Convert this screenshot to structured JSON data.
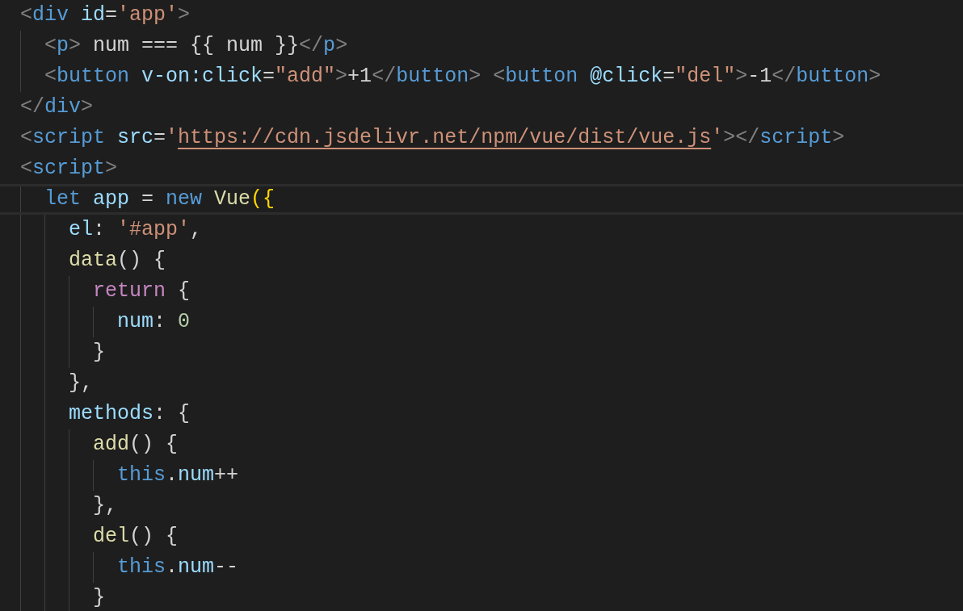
{
  "editor": {
    "lines": [
      {
        "current": false,
        "tokens": [
          {
            "text": "<",
            "kind": "punct"
          },
          {
            "text": "div",
            "kind": "tag"
          },
          {
            "text": " id",
            "kind": "attr"
          },
          {
            "text": "=",
            "kind": "plain"
          },
          {
            "text": "'app'",
            "kind": "string"
          },
          {
            "text": ">",
            "kind": "punct"
          }
        ]
      },
      {
        "current": false,
        "tokens": [
          {
            "text": "  <",
            "kind": "punct"
          },
          {
            "text": "p",
            "kind": "tag"
          },
          {
            "text": ">",
            "kind": "punct"
          },
          {
            "text": " num === {{ num }}",
            "kind": "plain"
          },
          {
            "text": "</",
            "kind": "punct"
          },
          {
            "text": "p",
            "kind": "tag"
          },
          {
            "text": ">",
            "kind": "punct"
          }
        ]
      },
      {
        "current": false,
        "tokens": [
          {
            "text": "  <",
            "kind": "punct"
          },
          {
            "text": "button",
            "kind": "tag"
          },
          {
            "text": " v-on:click",
            "kind": "attr"
          },
          {
            "text": "=",
            "kind": "plain"
          },
          {
            "text": "\"add\"",
            "kind": "string"
          },
          {
            "text": ">",
            "kind": "punct"
          },
          {
            "text": "+1",
            "kind": "plain"
          },
          {
            "text": "</",
            "kind": "punct"
          },
          {
            "text": "button",
            "kind": "tag"
          },
          {
            "text": ">",
            "kind": "punct"
          },
          {
            "text": " <",
            "kind": "punct"
          },
          {
            "text": "button",
            "kind": "tag"
          },
          {
            "text": " @click",
            "kind": "attr"
          },
          {
            "text": "=",
            "kind": "plain"
          },
          {
            "text": "\"del\"",
            "kind": "string"
          },
          {
            "text": ">",
            "kind": "punct"
          },
          {
            "text": "-1",
            "kind": "plain"
          },
          {
            "text": "</",
            "kind": "punct"
          },
          {
            "text": "button",
            "kind": "tag"
          },
          {
            "text": ">",
            "kind": "punct"
          }
        ]
      },
      {
        "current": false,
        "tokens": [
          {
            "text": "</",
            "kind": "punct"
          },
          {
            "text": "div",
            "kind": "tag"
          },
          {
            "text": ">",
            "kind": "punct"
          }
        ]
      },
      {
        "current": false,
        "tokens": [
          {
            "text": "<",
            "kind": "punct"
          },
          {
            "text": "script",
            "kind": "tag"
          },
          {
            "text": " src",
            "kind": "attr"
          },
          {
            "text": "=",
            "kind": "plain"
          },
          {
            "text": "'",
            "kind": "string"
          },
          {
            "text": "https://cdn.jsdelivr.net/npm/vue/dist/vue.js",
            "kind": "link"
          },
          {
            "text": "'",
            "kind": "string"
          },
          {
            "text": "></",
            "kind": "punct"
          },
          {
            "text": "script",
            "kind": "tag"
          },
          {
            "text": ">",
            "kind": "punct"
          }
        ]
      },
      {
        "current": false,
        "tokens": [
          {
            "text": "<",
            "kind": "punct"
          },
          {
            "text": "script",
            "kind": "tag"
          },
          {
            "text": ">",
            "kind": "punct"
          }
        ]
      },
      {
        "current": true,
        "tokens": [
          {
            "text": "  let",
            "kind": "keyword"
          },
          {
            "text": " app",
            "kind": "variable"
          },
          {
            "text": " = ",
            "kind": "plain"
          },
          {
            "text": "new",
            "kind": "keyword"
          },
          {
            "text": " Vue",
            "kind": "function"
          },
          {
            "text": "({",
            "kind": "bracket"
          }
        ]
      },
      {
        "current": false,
        "tokens": [
          {
            "text": "    el",
            "kind": "variable"
          },
          {
            "text": ": ",
            "kind": "plain"
          },
          {
            "text": "'#app'",
            "kind": "string"
          },
          {
            "text": ",",
            "kind": "plain"
          }
        ]
      },
      {
        "current": false,
        "tokens": [
          {
            "text": "    data",
            "kind": "function"
          },
          {
            "text": "() {",
            "kind": "plain"
          }
        ]
      },
      {
        "current": false,
        "tokens": [
          {
            "text": "      return",
            "kind": "control"
          },
          {
            "text": " {",
            "kind": "plain"
          }
        ]
      },
      {
        "current": false,
        "tokens": [
          {
            "text": "        num",
            "kind": "variable"
          },
          {
            "text": ": ",
            "kind": "plain"
          },
          {
            "text": "0",
            "kind": "number"
          }
        ]
      },
      {
        "current": false,
        "tokens": [
          {
            "text": "      }",
            "kind": "plain"
          }
        ]
      },
      {
        "current": false,
        "tokens": [
          {
            "text": "    },",
            "kind": "plain"
          }
        ]
      },
      {
        "current": false,
        "tokens": [
          {
            "text": "    methods",
            "kind": "variable"
          },
          {
            "text": ": {",
            "kind": "plain"
          }
        ]
      },
      {
        "current": false,
        "tokens": [
          {
            "text": "      add",
            "kind": "function"
          },
          {
            "text": "() {",
            "kind": "plain"
          }
        ]
      },
      {
        "current": false,
        "tokens": [
          {
            "text": "        this",
            "kind": "keyword"
          },
          {
            "text": ".",
            "kind": "plain"
          },
          {
            "text": "num",
            "kind": "variable"
          },
          {
            "text": "++",
            "kind": "plain"
          }
        ]
      },
      {
        "current": false,
        "tokens": [
          {
            "text": "      },",
            "kind": "plain"
          }
        ]
      },
      {
        "current": false,
        "tokens": [
          {
            "text": "      del",
            "kind": "function"
          },
          {
            "text": "() {",
            "kind": "plain"
          }
        ]
      },
      {
        "current": false,
        "tokens": [
          {
            "text": "        this",
            "kind": "keyword"
          },
          {
            "text": ".",
            "kind": "plain"
          },
          {
            "text": "num",
            "kind": "variable"
          },
          {
            "text": "--",
            "kind": "plain"
          }
        ]
      },
      {
        "current": false,
        "tokens": [
          {
            "text": "      }",
            "kind": "plain"
          }
        ]
      }
    ]
  }
}
